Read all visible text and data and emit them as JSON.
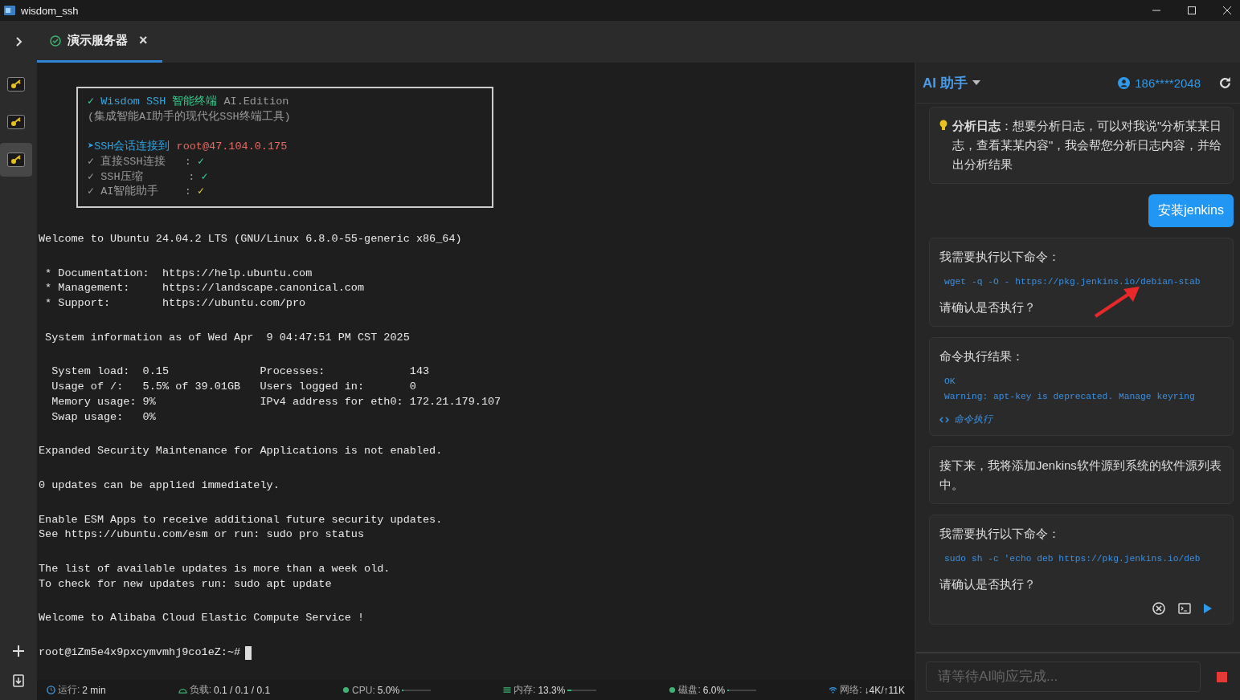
{
  "window": {
    "title": "wisdom_ssh"
  },
  "sidebar": {
    "items": [
      {
        "selected": false
      },
      {
        "selected": false
      },
      {
        "selected": true
      }
    ]
  },
  "tabs": [
    {
      "label": "演示服务器",
      "close": "×",
      "selected": true,
      "connected": true
    }
  ],
  "terminal": {
    "banner": [
      [
        [
          {
            "text": "✓ ",
            "kind": "ok"
          },
          {
            "text": "Wisdom SSH ",
            "kind": "brand"
          },
          {
            "text": "智能终端",
            "kind": "title"
          },
          {
            "text": " AI.Edition",
            "kind": "muted"
          }
        ],
        [
          {
            "text": "(集成智能AI助手的现代化SSH终端工具)",
            "kind": "muted"
          }
        ]
      ],
      [
        [
          {
            "text": "➤SSH会话连接到 ",
            "kind": "accent"
          },
          {
            "text": "root@47.104.0.175",
            "kind": "host"
          }
        ],
        [
          {
            "text": "✓ 直接SSH连接   : ",
            "kind": "muted"
          },
          {
            "text": "✓",
            "kind": "ok"
          }
        ],
        [
          {
            "text": "✓ SSH压缩       : ",
            "kind": "muted"
          },
          {
            "text": "✓",
            "kind": "ok"
          }
        ],
        [
          {
            "text": "✓ AI智能助手    : ",
            "kind": "muted"
          },
          {
            "text": "✓",
            "kind": "warn"
          }
        ]
      ]
    ],
    "blocks": [
      [
        "Welcome to Ubuntu 24.04.2 LTS (GNU/Linux 6.8.0-55-generic x86_64)"
      ],
      [
        " * Documentation:  https://help.ubuntu.com",
        " * Management:     https://landscape.canonical.com",
        " * Support:        https://ubuntu.com/pro"
      ],
      [
        " System information as of Wed Apr  9 04:47:51 PM CST 2025"
      ],
      [
        "  System load:  0.15              Processes:             143",
        "  Usage of /:   5.5% of 39.01GB   Users logged in:       0",
        "  Memory usage: 9%                IPv4 address for eth0: 172.21.179.107",
        "  Swap usage:   0%"
      ],
      [
        "Expanded Security Maintenance for Applications is not enabled."
      ],
      [
        "0 updates can be applied immediately."
      ],
      [
        "Enable ESM Apps to receive additional future security updates.",
        "See https://ubuntu.com/esm or run: sudo pro status"
      ],
      [
        "The list of available updates is more than a week old.",
        "To check for new updates run: sudo apt update"
      ],
      [
        "Welcome to Alibaba Cloud Elastic Compute Service !"
      ]
    ],
    "prompt": "root@iZm5e4x9pxcymvmhj9co1eZ:~#"
  },
  "status_bar": [
    {
      "kind": "uptime",
      "label": "运行:",
      "value": "2 min"
    },
    {
      "kind": "load",
      "label": "负载:",
      "value": "0.1 / 0.1 / 0.1"
    },
    {
      "kind": "cpu",
      "label": "CPU:",
      "value": "5.0%",
      "level": 0.05
    },
    {
      "kind": "memory",
      "label": "内存:",
      "value": "13.3%",
      "level": 0.133
    },
    {
      "kind": "disk",
      "label": "磁盘:",
      "value": "6.0%",
      "level": 0.06
    },
    {
      "kind": "network",
      "label": "网络:",
      "value": "↓4K/↑11K"
    }
  ],
  "assistant": {
    "title": "AI 助手",
    "user": "186****2048",
    "messages": [
      {
        "kind": "tip",
        "text": "**分析日志**：想要分析日志，可以对我说\"分析某某日志，查看某某内容\"，我会帮您分析日志内容，并给出分析结果"
      },
      {
        "kind": "user",
        "text": "安装jenkins"
      },
      {
        "kind": "command",
        "title": "我需要执行以下命令：",
        "code": [
          "wget -q -O - https://pkg.jenkins.io/debian-stab"
        ],
        "question": "请确认是否执行？",
        "actions": false
      },
      {
        "kind": "result",
        "title": "命令执行结果：",
        "code": [
          "OK",
          "Warning: apt-key is deprecated. Manage keyring"
        ],
        "link": "命令执行"
      },
      {
        "kind": "text",
        "text": "接下来，我将添加Jenkins软件源到系统的软件源列表中。"
      },
      {
        "kind": "command",
        "title": "我需要执行以下命令：",
        "code": [
          "sudo sh -c 'echo deb https://pkg.jenkins.io/deb"
        ],
        "question": "请确认是否执行？",
        "actions": true
      }
    ],
    "input": {
      "placeholder": "请等待AI响应完成...",
      "busy": true
    }
  }
}
